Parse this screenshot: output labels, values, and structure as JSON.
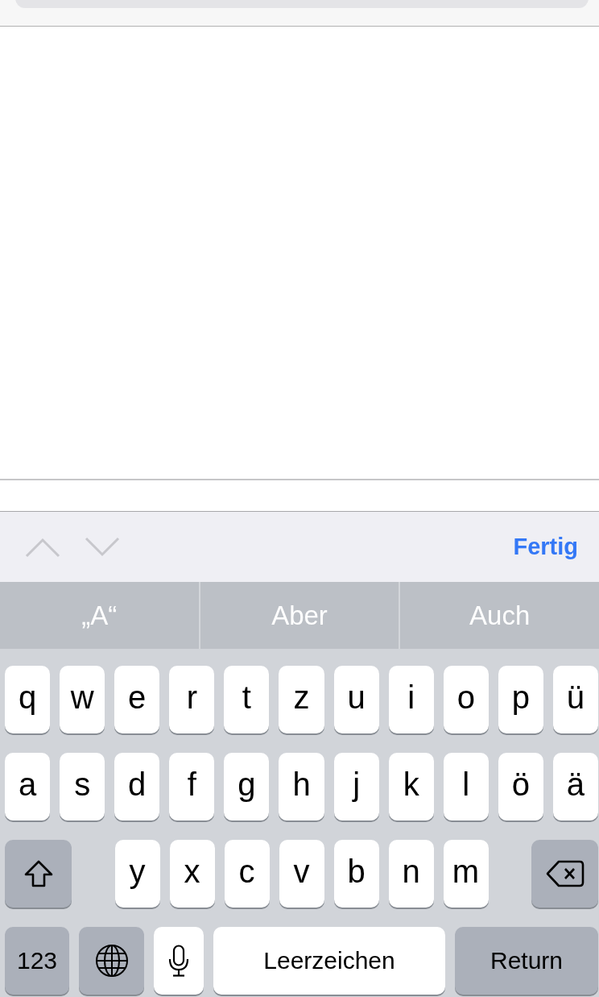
{
  "toolbar": {
    "previous": {
      "disabled": true
    },
    "next": {
      "disabled": true
    },
    "done": "Fertig"
  },
  "suggestions": [
    "„A“",
    "Aber",
    "Auch"
  ],
  "keyboard": {
    "row_1": [
      {
        "kind": "letter",
        "label": "q"
      },
      {
        "kind": "letter",
        "label": "w"
      },
      {
        "kind": "letter",
        "label": "e"
      },
      {
        "kind": "letter",
        "label": "r"
      },
      {
        "kind": "letter",
        "label": "t"
      },
      {
        "kind": "letter",
        "label": "z"
      },
      {
        "kind": "letter",
        "label": "u"
      },
      {
        "kind": "letter",
        "label": "i"
      },
      {
        "kind": "letter",
        "label": "o"
      },
      {
        "kind": "letter",
        "label": "p"
      },
      {
        "kind": "letter",
        "label": "ü"
      }
    ],
    "row_2": [
      {
        "kind": "letter",
        "label": "a"
      },
      {
        "kind": "letter",
        "label": "s"
      },
      {
        "kind": "letter",
        "label": "d"
      },
      {
        "kind": "letter",
        "label": "f"
      },
      {
        "kind": "letter",
        "label": "g"
      },
      {
        "kind": "letter",
        "label": "h"
      },
      {
        "kind": "letter",
        "label": "j"
      },
      {
        "kind": "letter",
        "label": "k"
      },
      {
        "kind": "letter",
        "label": "l"
      },
      {
        "kind": "letter",
        "label": "ö"
      },
      {
        "kind": "letter",
        "label": "ä"
      }
    ],
    "row_3": [
      {
        "kind": "shift"
      },
      {
        "kind": "letter",
        "label": "y"
      },
      {
        "kind": "letter",
        "label": "x"
      },
      {
        "kind": "letter",
        "label": "c"
      },
      {
        "kind": "letter",
        "label": "v"
      },
      {
        "kind": "letter",
        "label": "b"
      },
      {
        "kind": "letter",
        "label": "n"
      },
      {
        "kind": "letter",
        "label": "m"
      },
      {
        "kind": "backspace"
      }
    ],
    "bottom_row": [
      {
        "kind": "numbers",
        "label": "123"
      },
      {
        "kind": "globe"
      },
      {
        "kind": "mic"
      },
      {
        "kind": "space",
        "label": "Leerzeichen"
      },
      {
        "kind": "return",
        "label": "Return"
      }
    ]
  }
}
